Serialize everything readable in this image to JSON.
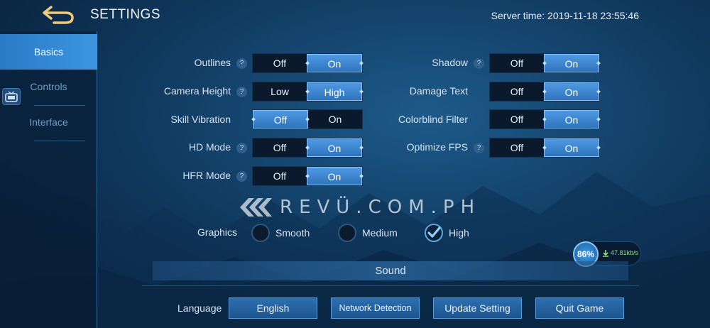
{
  "header": {
    "title": "SETTINGS",
    "server_time_label": "Server time:",
    "server_time_value": "2019-11-18 23:55:46"
  },
  "sidebar": {
    "items": [
      {
        "label": "Basics",
        "active": true
      },
      {
        "label": "Controls",
        "active": false
      },
      {
        "label": "Interface",
        "active": false
      }
    ]
  },
  "settings": {
    "left": [
      {
        "label": "Outlines",
        "help": "?",
        "options": [
          "Off",
          "On"
        ],
        "selected": "On"
      },
      {
        "label": "Camera Height",
        "help": "?",
        "options": [
          "Low",
          "High"
        ],
        "selected": "High"
      },
      {
        "label": "Skill Vibration",
        "help": "",
        "options": [
          "Off",
          "On"
        ],
        "selected": "Off"
      },
      {
        "label": "HD Mode",
        "help": "?",
        "options": [
          "Off",
          "On"
        ],
        "selected": "On"
      },
      {
        "label": "HFR Mode",
        "help": "?",
        "options": [
          "Off",
          "On"
        ],
        "selected": "On"
      }
    ],
    "right": [
      {
        "label": "Shadow",
        "help": "?",
        "options": [
          "Off",
          "On"
        ],
        "selected": "On"
      },
      {
        "label": "Damage Text",
        "help": "",
        "options": [
          "Off",
          "On"
        ],
        "selected": "On"
      },
      {
        "label": "Colorblind Filter",
        "help": "",
        "options": [
          "Off",
          "On"
        ],
        "selected": "On"
      },
      {
        "label": "Optimize FPS",
        "help": "?",
        "options": [
          "Off",
          "On"
        ],
        "selected": "On"
      }
    ]
  },
  "watermark": {
    "text": "REVÜ.COM.PH"
  },
  "graphics": {
    "label": "Graphics",
    "options": [
      "Smooth",
      "Medium",
      "High"
    ],
    "selected": "High"
  },
  "network": {
    "percent": "86%",
    "speed": "47.81kb/s"
  },
  "sound": {
    "label": "Sound"
  },
  "footer": {
    "language_label": "Language",
    "language_value": "English",
    "network_detection": "Network Detection",
    "update_setting": "Update Setting",
    "quit_game": "Quit Game"
  },
  "colors": {
    "accent": "#3d8fdc",
    "selected_toggle": "#4f9ae3",
    "background": "#123f66",
    "check": "#8fd0ff"
  }
}
